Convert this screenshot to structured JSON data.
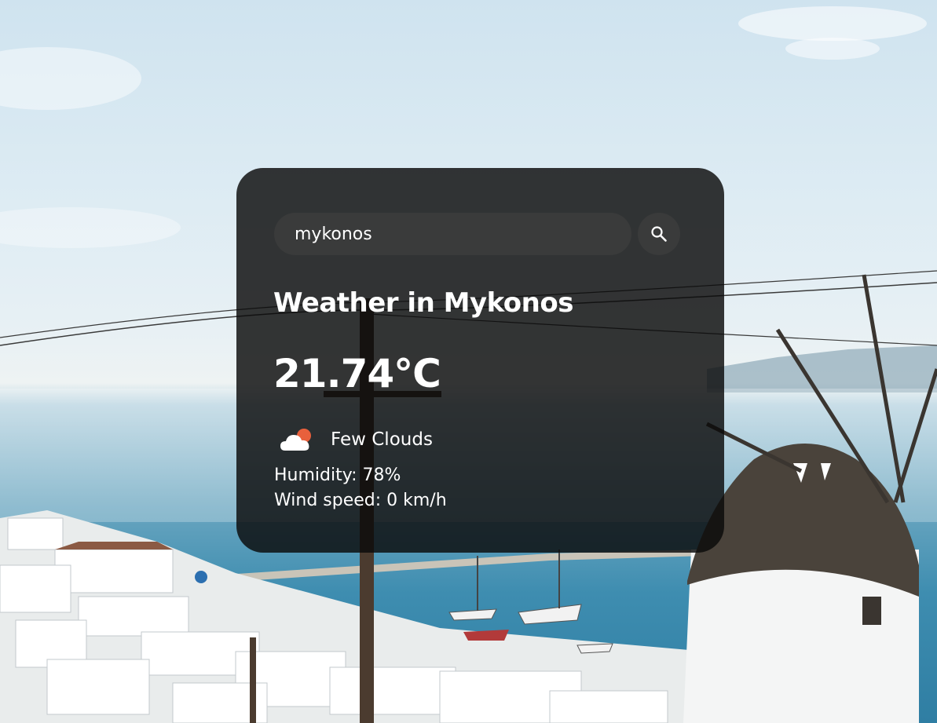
{
  "search": {
    "value": "mykonos",
    "placeholder": "Search"
  },
  "weather": {
    "title": "Weather in Mykonos",
    "temperature": "21.74°C",
    "condition": "Few Clouds",
    "condition_icon": "few-clouds-icon",
    "humidity": "Humidity: 78%",
    "wind": "Wind speed: 0 km/h"
  },
  "colors": {
    "card_bg": "rgba(10,10,10,0.82)",
    "input_bg": "#3a3b3b",
    "text": "#ffffff",
    "sun": "#e8603c"
  }
}
